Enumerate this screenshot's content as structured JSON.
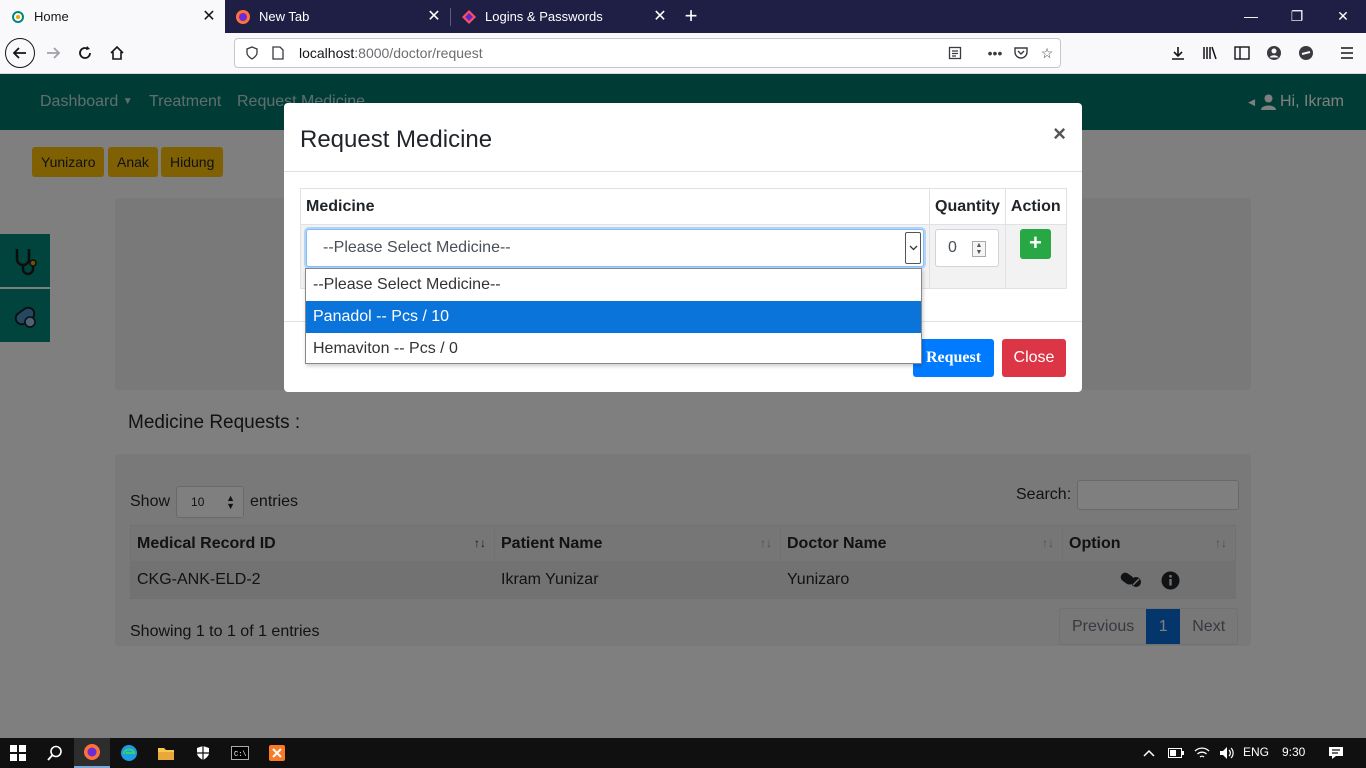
{
  "browser": {
    "tabs": [
      {
        "title": "Home",
        "active": true
      },
      {
        "title": "New Tab",
        "active": false
      },
      {
        "title": "Logins & Passwords",
        "active": false
      }
    ],
    "url_host": "localhost",
    "url_rest": ":8000/doctor/request"
  },
  "app": {
    "nav": {
      "dashboard": "Dashboard",
      "treatment": "Treatment",
      "request_medicine": "Request Medicine",
      "user": "Hi, Ikram"
    },
    "tags": [
      "Yunizaro",
      "Anak",
      "Hidung"
    ],
    "section_title": "Medicine Requests :",
    "datatable": {
      "show_label": "Show",
      "entries_value": "10",
      "entries_label": "entries",
      "search_label": "Search:",
      "columns": [
        "Medical Record ID",
        "Patient Name",
        "Doctor Name",
        "Option"
      ],
      "rows": [
        {
          "record_id": "CKG-ANK-ELD-2",
          "patient": "Ikram Yunizar",
          "doctor": "Yunizaro"
        }
      ],
      "info": "Showing 1 to 1 of 1 entries",
      "pager": {
        "previous": "Previous",
        "current": "1",
        "next": "Next"
      }
    }
  },
  "modal": {
    "title": "Request Medicine",
    "close_symbol": "×",
    "columns": {
      "medicine": "Medicine",
      "quantity": "Quantity",
      "action": "Action"
    },
    "select_value": "--Please Select Medicine--",
    "quantity_value": "0",
    "add_symbol": "+",
    "options": [
      {
        "label": "--Please Select Medicine--",
        "highlighted": false
      },
      {
        "label": "Panadol -- Pcs / 10",
        "highlighted": true
      },
      {
        "label": "Hemaviton -- Pcs / 0",
        "highlighted": false
      }
    ],
    "request_button": "Request",
    "close_button": "Close"
  },
  "taskbar": {
    "language": "ENG",
    "time": "9:30"
  },
  "colors": {
    "app_nav": "#00796b",
    "tag": "#ffc107",
    "primary": "#007bff",
    "danger": "#dc3545",
    "success": "#28a745"
  }
}
